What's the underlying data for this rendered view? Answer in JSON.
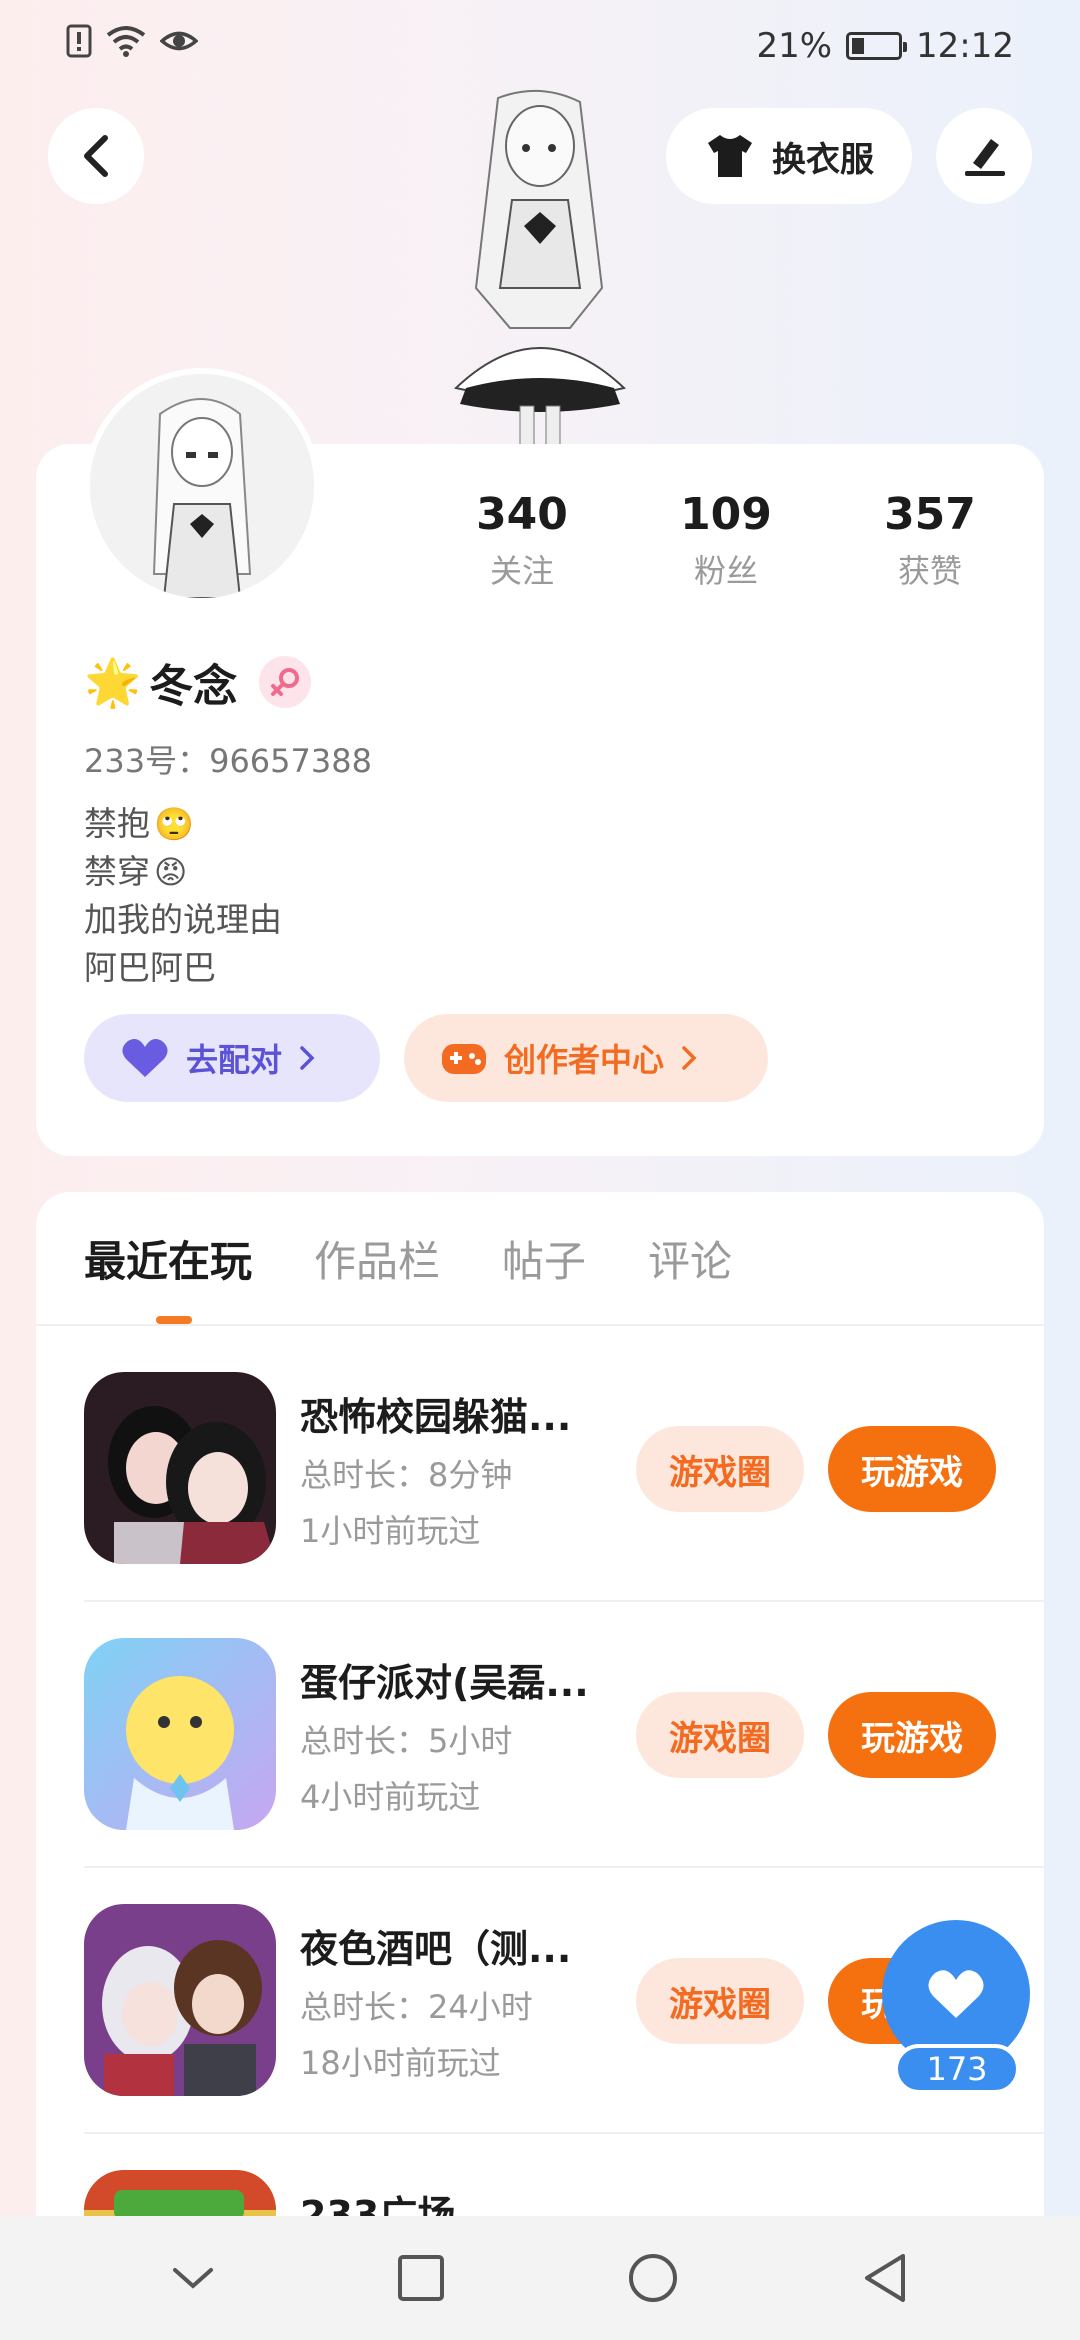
{
  "status_bar": {
    "battery_percent": "21%",
    "time": "12:12",
    "icons": [
      "alert-icon",
      "wifi-icon",
      "eye-icon",
      "battery-icon"
    ]
  },
  "header": {
    "back_icon": "back-arrow-icon",
    "outfit_label": "换衣服",
    "edit_icon": "edit-icon"
  },
  "profile": {
    "stats": [
      {
        "value": "340",
        "label": "关注"
      },
      {
        "value": "109",
        "label": "粉丝"
      },
      {
        "value": "357",
        "label": "获赞"
      }
    ],
    "name_emoji": "🌟",
    "name": "冬念",
    "gender": "female",
    "uid": "233号：96657388",
    "bio": [
      {
        "text": "禁抱",
        "emoji": "🙄"
      },
      {
        "text": "禁穿",
        "emoji": "😡"
      },
      {
        "text": "加我的说理由",
        "emoji": ""
      },
      {
        "text": "阿巴阿巴",
        "emoji": ""
      }
    ],
    "pair_label": "去配对",
    "creator_label": "创作者中心"
  },
  "tabs": [
    "最近在玩",
    "作品栏",
    "帖子",
    "评论"
  ],
  "games": [
    {
      "title": "恐怖校园躲猫...",
      "duration": "总时长：8分钟",
      "last_played": "1小时前玩过",
      "circle_label": "游戏圈",
      "play_label": "玩游戏"
    },
    {
      "title": "蛋仔派对(吴磊...",
      "duration": "总时长：5小时",
      "last_played": "4小时前玩过",
      "circle_label": "游戏圈",
      "play_label": "玩游戏"
    },
    {
      "title": "夜色酒吧（测...",
      "duration": "总时长：24小时",
      "last_played": "18小时前玩过",
      "circle_label": "游戏圈",
      "play_label": "玩游戏"
    },
    {
      "title": "233广场"
    }
  ],
  "like_fab": {
    "count": "173"
  },
  "colors": {
    "accent_orange": "#f5700f",
    "pair_purple": "#5b52d6",
    "like_blue": "#3a8ef0"
  }
}
